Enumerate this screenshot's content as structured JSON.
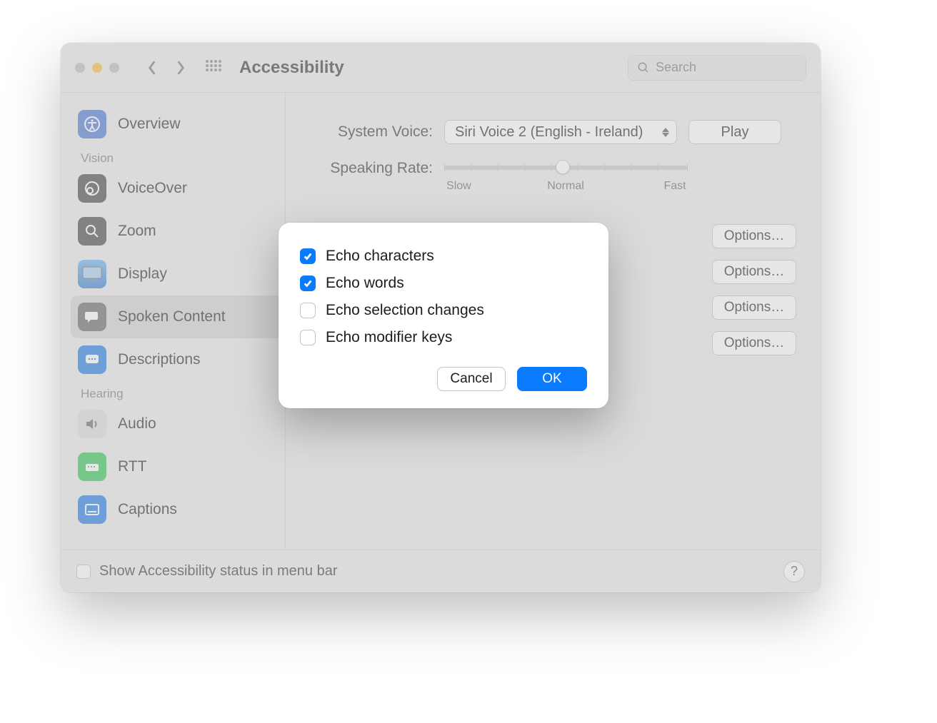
{
  "header": {
    "title": "Accessibility",
    "search_placeholder": "Search"
  },
  "sidebar": {
    "items": [
      {
        "label": "Overview"
      },
      {
        "label": "VoiceOver"
      },
      {
        "label": "Zoom"
      },
      {
        "label": "Display"
      },
      {
        "label": "Spoken Content"
      },
      {
        "label": "Descriptions"
      },
      {
        "label": "Audio"
      },
      {
        "label": "RTT"
      },
      {
        "label": "Captions"
      }
    ],
    "group_vision": "Vision",
    "group_hearing": "Hearing"
  },
  "main": {
    "system_voice_label": "System Voice:",
    "system_voice_value": "Siri Voice 2 (English - Ireland)",
    "play_label": "Play",
    "speaking_rate_label": "Speaking Rate:",
    "rate_slow": "Slow",
    "rate_normal": "Normal",
    "rate_fast": "Fast",
    "options_label": "Options…"
  },
  "footer": {
    "status_label": "Show Accessibility status in menu bar",
    "help_label": "?"
  },
  "modal": {
    "options": [
      {
        "label": "Echo characters",
        "checked": true
      },
      {
        "label": "Echo words",
        "checked": true
      },
      {
        "label": "Echo selection changes",
        "checked": false
      },
      {
        "label": "Echo modifier keys",
        "checked": false
      }
    ],
    "cancel": "Cancel",
    "ok": "OK"
  }
}
